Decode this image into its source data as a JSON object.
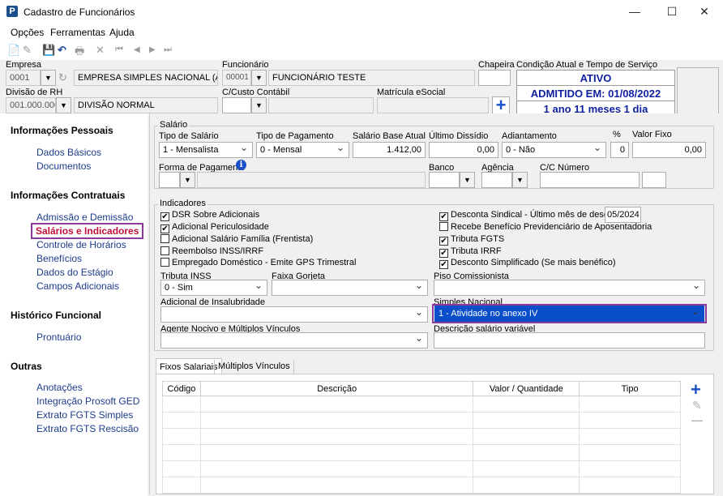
{
  "window": {
    "title": "Cadastro de Funcionários",
    "logo": "P",
    "minimize": "—",
    "maximize": "☐",
    "close": "✕"
  },
  "menu": {
    "opcoes": "Opções",
    "ferramentas": "Ferramentas",
    "ajuda": "Ajuda"
  },
  "toolbar": {
    "new": "📄",
    "edit": "✎",
    "save": "💾",
    "undo": "↶",
    "print": "🖶",
    "delete": "✕",
    "first": "⏮",
    "prev": "◀",
    "next": "▶",
    "last": "⏭"
  },
  "header": {
    "empresa_label": "Empresa",
    "empresa_code": "0001",
    "empresa_name": "EMPRESA SIMPLES NACIONAL (ANEXO I",
    "funcionario_label": "Funcionário",
    "funcionario_code": "00001",
    "funcionario_name": "FUNCIONÁRIO TESTE",
    "chapeira_label": "Chapeira",
    "chapeira_value": "",
    "condicao_label": "Condição Atual e Tempo de Serviço",
    "status": "ATIVO",
    "admitido": "ADMITIDO EM: 01/08/2022",
    "tempo": "1 ano 11 meses 1 dia",
    "divisao_label": "Divisão de RH",
    "divisao_code": "001.000.000",
    "divisao_name": "DIVISÃO NORMAL",
    "custo_label": "C/Custo Contábil",
    "matricula_label": "Matrícula eSocial",
    "add_icon": "+"
  },
  "nav": {
    "informacoes_pessoais": "Informações Pessoais",
    "dados_basicos": "Dados Básicos",
    "documentos": "Documentos",
    "informacoes_contratuais": "Informações Contratuais",
    "admissao": "Admissão e Demissão",
    "salarios": "Salários e Indicadores",
    "horarios": "Controle de Horários",
    "beneficios": "Benefícios",
    "estagio": "Dados do Estágio",
    "campos": "Campos Adicionais",
    "historico": "Histórico Funcional",
    "prontuario": "Prontuário",
    "outras": "Outras",
    "anotacoes": "Anotações",
    "prosoft": "Integração Prosoft GED",
    "fgts_simples": "Extrato FGTS Simples",
    "fgts_rescisao": "Extrato FGTS Rescisão"
  },
  "salario": {
    "group": "Salário",
    "tipo_salario_label": "Tipo de Salário",
    "tipo_salario": "1 - Mensalista",
    "tipo_pagamento_label": "Tipo de Pagamento",
    "tipo_pagamento": "0 - Mensal",
    "salario_base_label": "Salário Base Atual",
    "salario_base": "1.412,00",
    "ultimo_dissidio_label": "Último Dissídio",
    "ultimo_dissidio": "0,00",
    "adiantamento_label": "Adiantamento",
    "adiantamento": "0 - Não",
    "pct_label": "%",
    "pct": "0",
    "valor_fixo_label": "Valor Fixo",
    "valor_fixo": "0,00",
    "forma_label": "Forma de Pagamento",
    "info_icon": "i",
    "banco_label": "Banco",
    "agencia_label": "Agência",
    "cc_label": "C/C Número"
  },
  "indicadores": {
    "group": "Indicadores",
    "left": [
      {
        "label": "DSR Sobre Adicionais",
        "mark": "✔"
      },
      {
        "label": "Adicional Periculosidade",
        "mark": "✔"
      },
      {
        "label": "Adicional Salário Família (Frentista)",
        "mark": ""
      },
      {
        "label": "Reembolso INSS/IRRF",
        "mark": ""
      },
      {
        "label": "Empregado Doméstico - Emite GPS Trimestral",
        "mark": ""
      }
    ],
    "right": [
      {
        "label": "Desconta Sindical - Último mês de desconto",
        "mark": "✔"
      },
      {
        "label": "Recebe Benefício Previdenciário de Aposentadoria",
        "mark": ""
      },
      {
        "label": "Tributa FGTS",
        "mark": "✔"
      },
      {
        "label": "Tributa IRRF",
        "mark": "✔"
      },
      {
        "label": "Desconto Simplificado (Se mais benéfico)",
        "mark": "✔"
      }
    ],
    "sindical_mes": "05/2024",
    "tributa_inss_label": "Tributa INSS",
    "tributa_inss": "0 - Sim",
    "faixa_label": "Faixa Gorjeta",
    "piso_label": "Piso Comissionista",
    "insalubridade_label": "Adicional de Insalubridade",
    "simples_label": "Simples Nacional",
    "simples": "1 - Atividade no anexo IV",
    "agente_label": "Agente Nocivo e  Múltiplos Vínculos",
    "descricao_label": "Descrição salário variável"
  },
  "tabs": {
    "fixos": "Fixos Salariais",
    "multiplos": "Múltiplos Vínculos"
  },
  "grid": {
    "codigo": "Código",
    "descricao": "Descrição",
    "valor": "Valor / Quantidade",
    "tipo": "Tipo"
  },
  "grid_actions": {
    "add": "+",
    "edit": "✎",
    "remove": "—"
  }
}
